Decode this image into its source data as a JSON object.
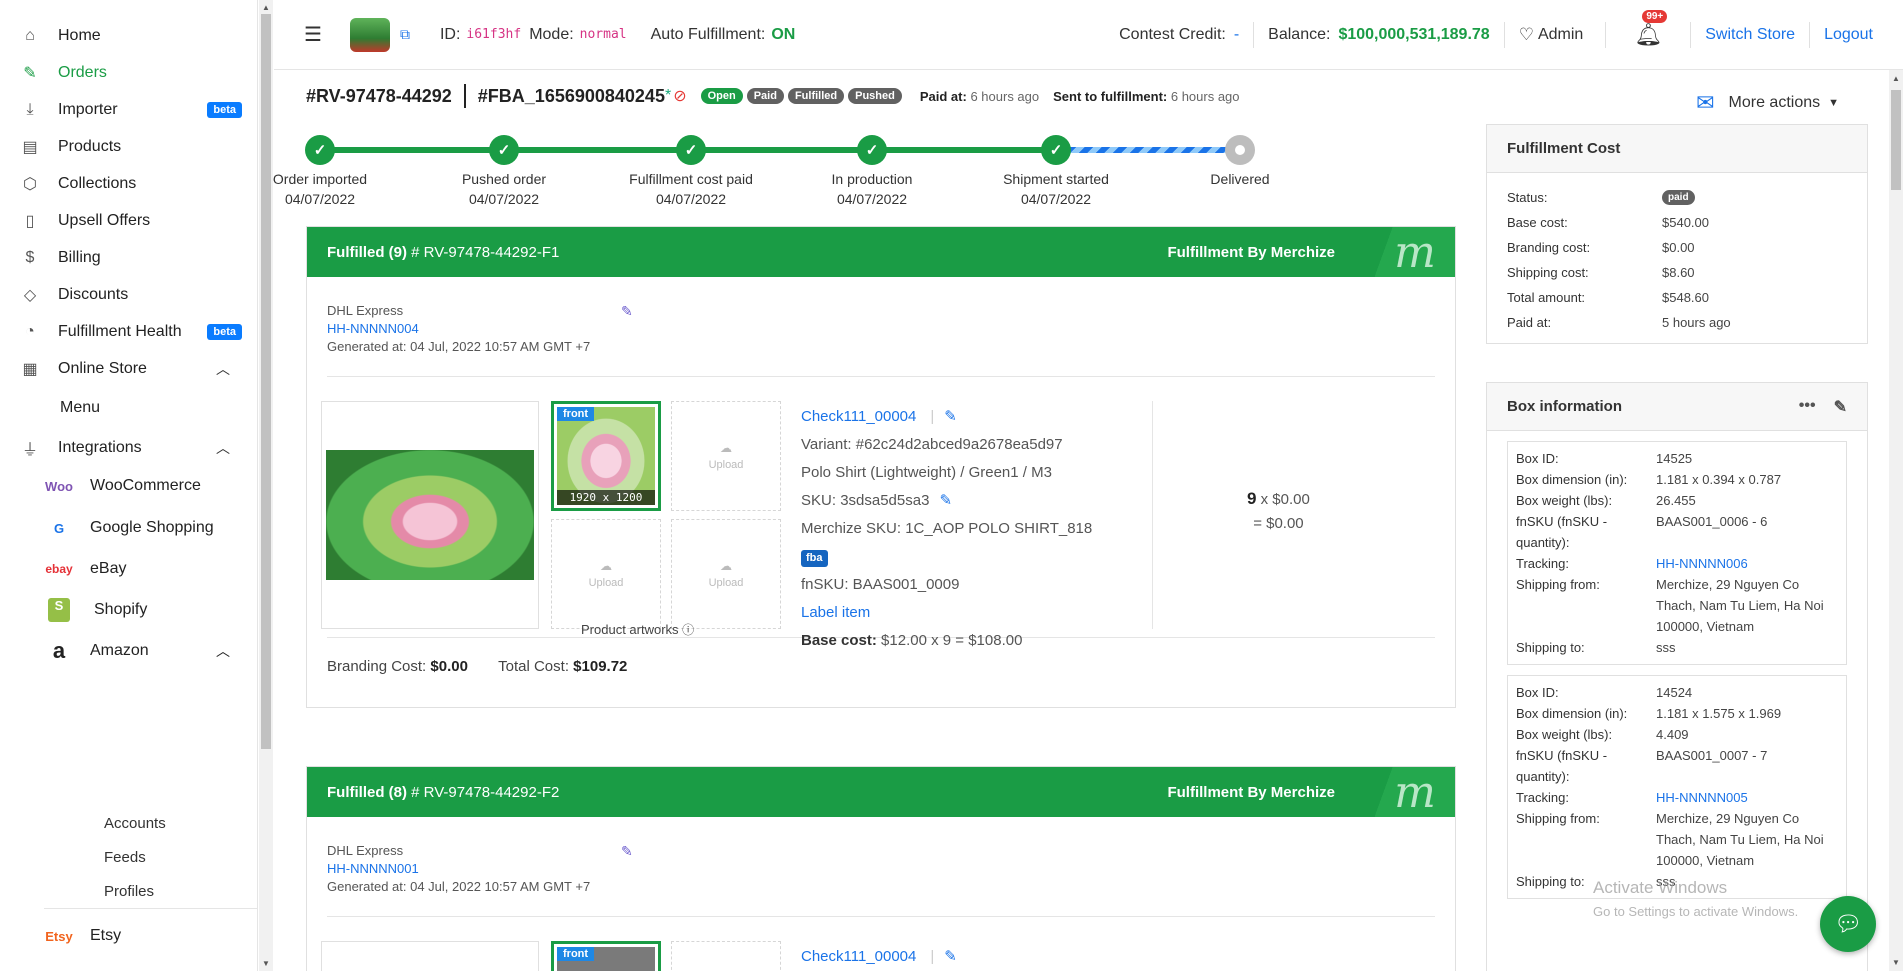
{
  "sidebar": {
    "items": [
      {
        "label": "Home",
        "icon": "home-icon"
      },
      {
        "label": "Orders",
        "icon": "edit-icon"
      },
      {
        "label": "Importer",
        "icon": "download-icon",
        "badge": "beta"
      },
      {
        "label": "Products",
        "icon": "archive-icon"
      },
      {
        "label": "Collections",
        "icon": "cube-icon"
      },
      {
        "label": "Upsell Offers",
        "icon": "bookmark-icon"
      },
      {
        "label": "Billing",
        "icon": "dollar-icon"
      },
      {
        "label": "Discounts",
        "icon": "tag-icon"
      },
      {
        "label": "Fulfillment Health",
        "icon": "pie-icon",
        "badge": "beta"
      },
      {
        "label": "Online Store",
        "icon": "store-icon"
      },
      {
        "label": "Menu"
      },
      {
        "label": "Integrations",
        "icon": "plug-icon"
      }
    ],
    "integrations": [
      {
        "label": "WooCommerce",
        "logo": "Woo"
      },
      {
        "label": "Google Shopping",
        "logo": "G"
      },
      {
        "label": "eBay",
        "logo": "ebay"
      },
      {
        "label": "Shopify",
        "logo": "S"
      },
      {
        "label": "Amazon",
        "logo": "a"
      }
    ],
    "amazon_sub": [
      "Accounts",
      "Feeds",
      "Profiles"
    ],
    "etsy": {
      "label": "Etsy",
      "logo": "Etsy"
    }
  },
  "topbar": {
    "id_label": "ID:",
    "id_value": "i61f3hf",
    "mode_label": "Mode:",
    "mode_value": "normal",
    "auto_label": "Auto Fulfillment:",
    "auto_value": "ON",
    "contest_label": "Contest Credit:",
    "contest_value": "-",
    "balance_label": "Balance:",
    "balance_value": "$100,000,531,189.78",
    "admin": "Admin",
    "notif_badge": "99+",
    "switch_store": "Switch Store",
    "logout": "Logout"
  },
  "order": {
    "id": "#RV-97478-44292",
    "fba": "#FBA_1656900840245",
    "fba_mark": "*",
    "pills": [
      "Open",
      "Paid",
      "Fulfilled",
      "Pushed"
    ],
    "paid_label": "Paid at:",
    "paid_value": "6 hours ago",
    "sent_label": "Sent to fulfillment:",
    "sent_value": "6 hours ago",
    "more_actions": "More actions"
  },
  "progress": [
    {
      "name": "Order imported",
      "date": "04/07/2022",
      "done": true
    },
    {
      "name": "Pushed order",
      "date": "04/07/2022",
      "done": true
    },
    {
      "name": "Fulfillment cost paid",
      "date": "04/07/2022",
      "done": true
    },
    {
      "name": "In production",
      "date": "04/07/2022",
      "done": true
    },
    {
      "name": "Shipment started",
      "date": "04/07/2022",
      "done": true
    },
    {
      "name": "Delivered",
      "date": "",
      "done": false
    }
  ],
  "fulfillments": [
    {
      "status": "Fulfilled (9)",
      "code": "# RV-97478-44292-F1",
      "by": "Fulfillment By Merchize",
      "carrier": "DHL Express",
      "tracking": "HH-NNNNN004",
      "generated": "Generated at: 04 Jul, 2022 10:57 AM GMT +7",
      "item": {
        "title": "Check111_00004",
        "variant": "Variant: #62c24d2abced9a2678ea5d97",
        "variant_name": "Polo Shirt (Lightweight) / Green1 / M3",
        "sku_label": "SKU:",
        "sku": "3sdsa5d5sa3",
        "merchize_sku": "Merchize SKU: 1C_AOP POLO SHIRT_818",
        "fba_tag": "fba",
        "fnsku": "fnSKU: BAAS001_0009",
        "label_item": "Label item",
        "base_cost_label": "Base cost:",
        "base_cost": "$12.00 x 9 = $108.00",
        "artwork_tag": "front",
        "artwork_size": "1920 x 1200",
        "upload": "Upload",
        "artworks_caption": "Product artworks",
        "qty": "9",
        "qty_price": "x $0.00",
        "qty_total": "= $0.00"
      },
      "branding_label": "Branding Cost:",
      "branding": "$0.00",
      "total_label": "Total Cost:",
      "total": "$109.72"
    },
    {
      "status": "Fulfilled (8)",
      "code": "# RV-97478-44292-F2",
      "by": "Fulfillment By Merchize",
      "carrier": "DHL Express",
      "tracking": "HH-NNNNN001",
      "generated": "Generated at: 04 Jul, 2022 10:57 AM GMT +7",
      "item": {
        "title": "Check111_00004",
        "artwork_tag": "front"
      }
    }
  ],
  "fulfillment_cost": {
    "title": "Fulfillment Cost",
    "rows": [
      {
        "k": "Status:",
        "v": "paid"
      },
      {
        "k": "Base cost:",
        "v": "$540.00"
      },
      {
        "k": "Branding cost:",
        "v": "$0.00"
      },
      {
        "k": "Shipping cost:",
        "v": "$8.60"
      },
      {
        "k": "Total amount:",
        "v": "$548.60"
      },
      {
        "k": "Paid at:",
        "v": "5 hours ago"
      }
    ]
  },
  "box_info": {
    "title": "Box information",
    "boxes": [
      {
        "rows": [
          {
            "k": "Box ID:",
            "v": "14525"
          },
          {
            "k": "Box dimension (in):",
            "v": "1.181 x 0.394 x 0.787"
          },
          {
            "k": "Box weight (lbs):",
            "v": "26.455"
          },
          {
            "k": "fnSKU (fnSKU - quantity):",
            "v": "BAAS001_0006 - 6"
          },
          {
            "k": "Tracking:",
            "v": "HH-NNNNN006"
          },
          {
            "k": "Shipping from:",
            "v": "Merchize, 29 Nguyen Co Thach, Nam Tu Liem, Ha Noi 100000, Vietnam"
          },
          {
            "k": "Shipping to:",
            "v": "sss"
          }
        ]
      },
      {
        "rows": [
          {
            "k": "Box ID:",
            "v": "14524"
          },
          {
            "k": "Box dimension (in):",
            "v": "1.181 x 1.575 x 1.969"
          },
          {
            "k": "Box weight (lbs):",
            "v": "4.409"
          },
          {
            "k": "fnSKU (fnSKU - quantity):",
            "v": "BAAS001_0007 - 7"
          },
          {
            "k": "Tracking:",
            "v": "HH-NNNNN005"
          },
          {
            "k": "Shipping from:",
            "v": "Merchize, 29 Nguyen Co Thach, Nam Tu Liem, Ha Noi 100000, Vietnam"
          },
          {
            "k": "Shipping to:",
            "v": "sss"
          }
        ]
      }
    ]
  },
  "watermark": {
    "line1": "Activate Windows",
    "line2": "Go to Settings to activate Windows."
  },
  "colors": {
    "accent": "#1a9c45",
    "link": "#1a73e8",
    "danger": "#e53935"
  }
}
